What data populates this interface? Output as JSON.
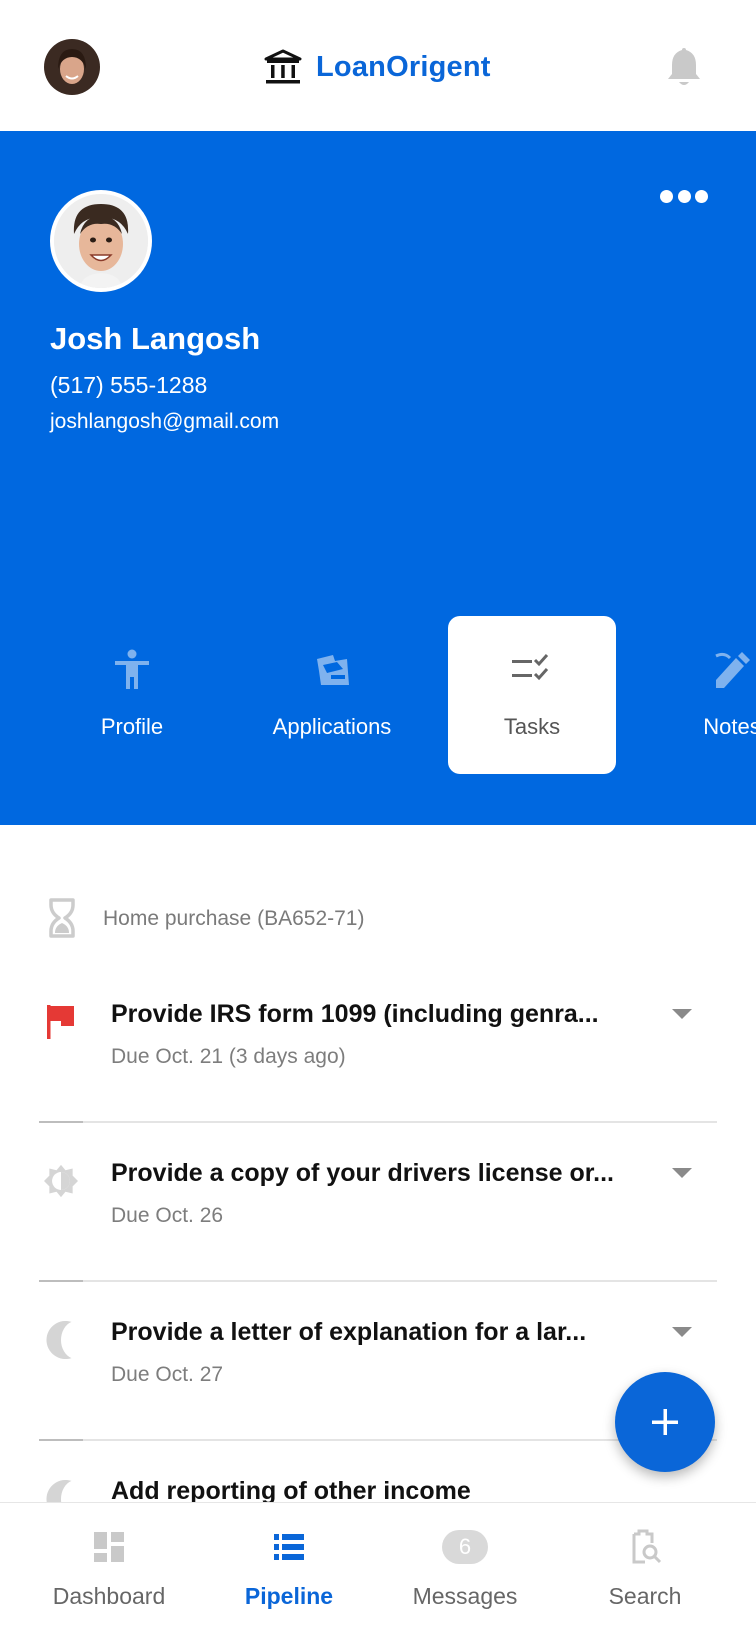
{
  "app": {
    "brand": "LoanOrigent",
    "accent": "#0068e0"
  },
  "contact": {
    "name": "Josh Langosh",
    "phone": "(517) 555-1288",
    "email": "joshlangosh@gmail.com"
  },
  "tabs": [
    {
      "label": "Profile",
      "icon": "person-icon"
    },
    {
      "label": "Applications",
      "icon": "applications-icon"
    },
    {
      "label": "Tasks",
      "icon": "tasks-icon",
      "active": true
    },
    {
      "label": "Notes",
      "icon": "notes-icon"
    }
  ],
  "application": {
    "label": "Home purchase (BA652-71)",
    "icon": "hourglass-icon"
  },
  "tasks": [
    {
      "title": "Provide IRS form 1099 (including genra...",
      "due": "Due Oct. 21 (3 days ago)",
      "icon": "red-flag-icon",
      "status_color": "#e53935"
    },
    {
      "title": "Provide a copy of your drivers license or...",
      "due": "Due Oct. 26",
      "icon": "half-sun-icon"
    },
    {
      "title": "Provide a letter of explanation for a lar...",
      "due": "Due Oct. 27",
      "icon": "crescent-moon-icon"
    },
    {
      "title": "Add reporting of other income",
      "due": "",
      "icon": "crescent-moon-icon"
    }
  ],
  "nav": [
    {
      "label": "Dashboard",
      "icon": "dashboard-icon"
    },
    {
      "label": "Pipeline",
      "icon": "pipeline-icon",
      "active": true
    },
    {
      "label": "Messages",
      "icon": "messages-icon",
      "badge": "6"
    },
    {
      "label": "Search",
      "icon": "search-icon"
    }
  ]
}
